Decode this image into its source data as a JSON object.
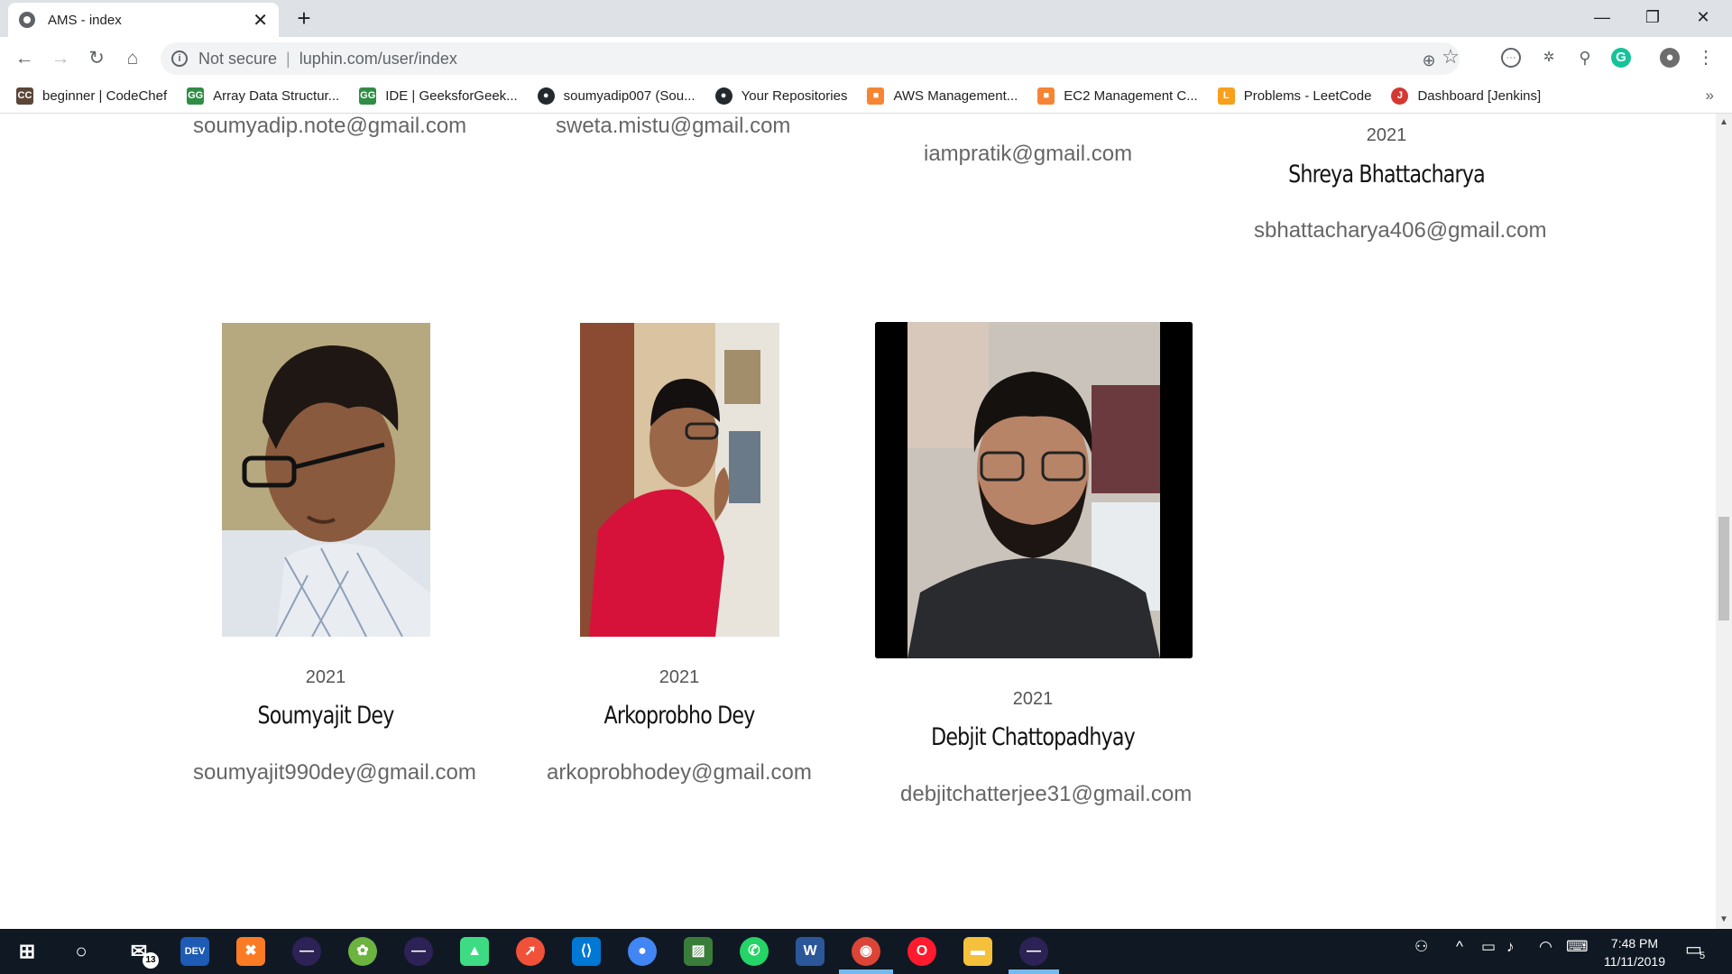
{
  "browser": {
    "tab_title": "AMS - index",
    "tab_close": "✕",
    "new_tab": "+",
    "security_label": "Not secure",
    "separator": "|",
    "url": "luphin.com/user/index"
  },
  "bookmarks": [
    {
      "label": "beginner | CodeChef",
      "icon": "codechef-icon",
      "color": "#5b4638",
      "glyph": "CC"
    },
    {
      "label": "Array Data Structur...",
      "icon": "geeksforgeeks-icon",
      "color": "#2f8d46",
      "glyph": "GG"
    },
    {
      "label": "IDE | GeeksforGeek...",
      "icon": "geeksforgeeks-icon",
      "color": "#2f8d46",
      "glyph": "GG"
    },
    {
      "label": "soumyadip007 (Sou...",
      "icon": "github-icon",
      "color": "#24292e",
      "glyph": "●"
    },
    {
      "label": "Your Repositories",
      "icon": "github-icon",
      "color": "#24292e",
      "glyph": "●"
    },
    {
      "label": "AWS Management...",
      "icon": "aws-icon",
      "color": "#f58534",
      "glyph": "■"
    },
    {
      "label": "EC2 Management C...",
      "icon": "aws-icon",
      "color": "#f58534",
      "glyph": "■"
    },
    {
      "label": "Problems - LeetCode",
      "icon": "leetcode-icon",
      "color": "#f89f1b",
      "glyph": "L"
    },
    {
      "label": "Dashboard [Jenkins]",
      "icon": "jenkins-icon",
      "color": "#d33833",
      "glyph": "J"
    }
  ],
  "members_top": [
    {
      "email": "soumyadip.note@gmail.com"
    },
    {
      "email": "sweta.mistu@gmail.com"
    },
    {
      "email": "iampratik@gmail.com"
    },
    {
      "year": "2021",
      "name": "Shreya Bhattacharya",
      "email": "sbhattacharya406@gmail.com"
    }
  ],
  "members": [
    {
      "year": "2021",
      "name": "Soumyajit Dey",
      "email": "soumyajit990dey@gmail.com"
    },
    {
      "year": "2021",
      "name": "Arkoprobho Dey",
      "email": "arkoprobhodey@gmail.com"
    },
    {
      "year": "2021",
      "name": "Debjit Chattopadhyay",
      "email": "debjitchatterjee31@gmail.com"
    }
  ],
  "taskbar": {
    "mail_badge": "13",
    "time": "7:48 PM",
    "date": "11/11/2019",
    "notification_count": "5"
  },
  "colors": {
    "accent_active": "#76b9ed",
    "taskbar_bg": "#101923"
  }
}
